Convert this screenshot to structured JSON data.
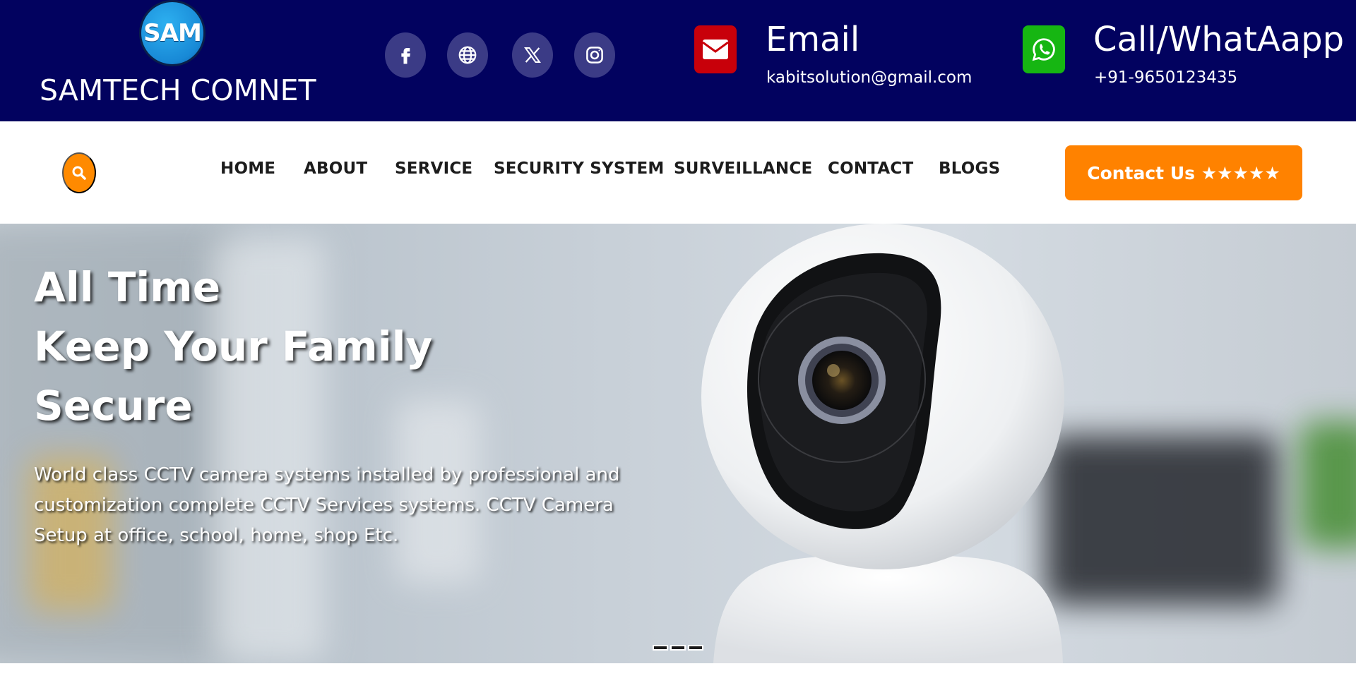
{
  "brand": {
    "logo_text": "SAM",
    "name": "SAMTECH COMNET"
  },
  "socials": [
    {
      "icon": "facebook-icon"
    },
    {
      "icon": "globe-icon"
    },
    {
      "icon": "x-twitter-icon"
    },
    {
      "icon": "instagram-icon"
    }
  ],
  "email": {
    "title": "Email",
    "value": "kabitsolution@gmail.com",
    "icon": "envelope-icon",
    "color": "#c8000a"
  },
  "phone": {
    "title": "Call/WhatAapp",
    "value": "+91-9650123435",
    "icon": "whatsapp-icon",
    "color": "#16b612"
  },
  "nav": {
    "items": [
      "HOME",
      "ABOUT",
      "SERVICE",
      "SECURITY SYSTEM",
      "SURVEILLANCE",
      "CONTACT",
      "BLOGS"
    ],
    "cta_label": "Contact Us ★★★★★"
  },
  "hero": {
    "lines": [
      "All Time",
      "Keep Your Family",
      "Secure"
    ],
    "description": "World class CCTV camera systems installed by professional and customization complete CCTV Services systems. CCTV Camera Setup at office, school, home, shop Etc.",
    "slides": 3
  },
  "colors": {
    "topbar": "#02025f",
    "accent": "#ff8200",
    "social_bg": "#3b3b86"
  }
}
